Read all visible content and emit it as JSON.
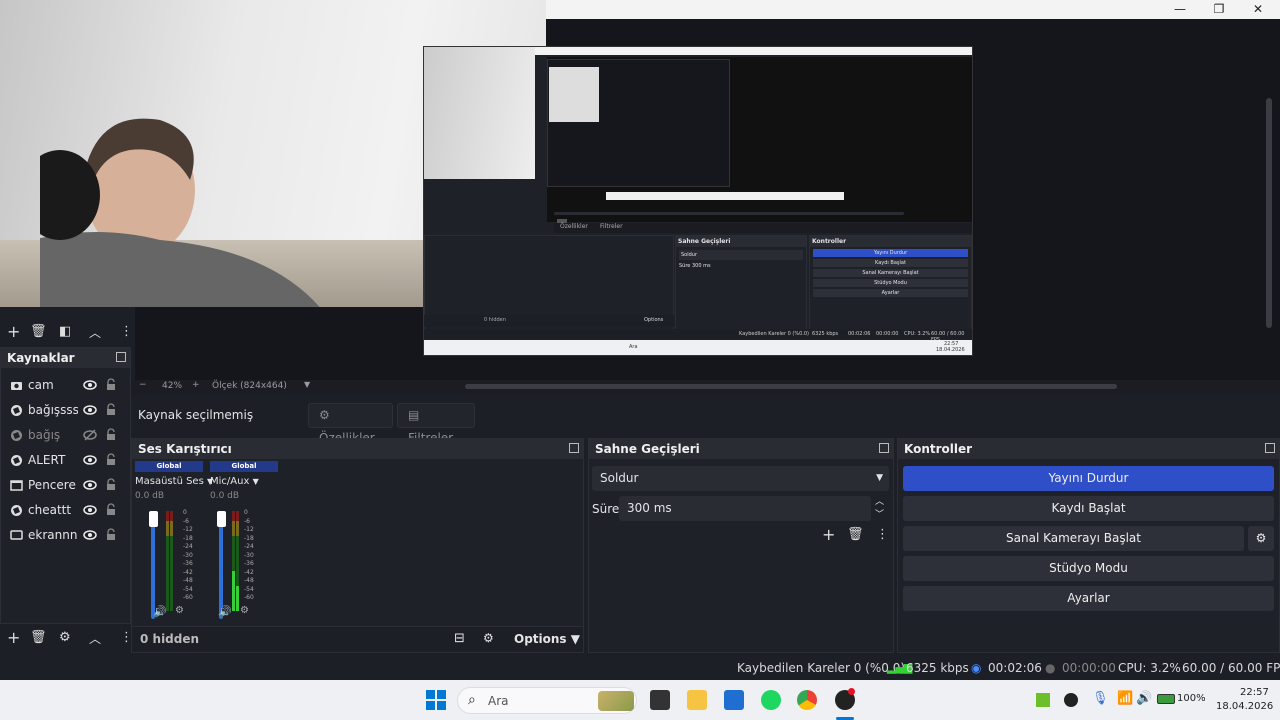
{
  "window": {
    "controls": [
      "—",
      "❐",
      "✕"
    ]
  },
  "preview": {
    "zoom_minus": "−",
    "zoom_percent": "42%",
    "zoom_plus": "+",
    "scale_label": "Ölçek (824x464)"
  },
  "nested_preview": {
    "controls_buttons": [
      "Yayını Durdur",
      "Kaydı Başlat",
      "Sanal Kamerayı Başlat",
      "Stüdyo Modu",
      "Ayarlar"
    ],
    "transitions_title": "Sahne Geçişleri",
    "controls_title": "Kontroller",
    "transition": "Soldur",
    "duration_label": "Süre",
    "duration": "300 ms",
    "tabs": [
      "Özellikler",
      "Filtreler"
    ],
    "hidden": "0 hidden",
    "options": "Options",
    "status": "Kaybedilen Kareler 0 (%0.0)",
    "kbps": "6325 kbps",
    "time": "00:02:06",
    "rec": "00:00:00",
    "cpu": "CPU: 3.2%",
    "fps": "60.00 / 60.00 FPS",
    "search": "Ara",
    "clock_time": "22:57",
    "clock_date": "18.04.2026"
  },
  "properties_bar": {
    "no_source": "Kaynak seçilmemiş",
    "properties": "Özellikler",
    "filters": "Filtreler"
  },
  "sources": {
    "title": "Kaynaklar",
    "items": [
      {
        "label": "cam",
        "icon": "camera-icon",
        "visible": true
      },
      {
        "label": "bağışsssss",
        "icon": "browser-icon",
        "visible": true
      },
      {
        "label": "bağış",
        "icon": "browser-icon",
        "visible": false
      },
      {
        "label": "ALERT",
        "icon": "browser-icon",
        "visible": true
      },
      {
        "label": "Pencere Y",
        "icon": "window-icon",
        "visible": true
      },
      {
        "label": "cheattt",
        "icon": "browser-icon",
        "visible": true
      },
      {
        "label": "ekrannnn",
        "icon": "monitor-icon",
        "visible": true
      }
    ]
  },
  "mixer": {
    "title": "Ses Karıştırıcı",
    "channels": [
      {
        "global": "Global",
        "name": "Masaüstü Ses",
        "db": "0.0 dB"
      },
      {
        "global": "Global",
        "name": "Mic/Aux",
        "db": "0.0 dB"
      }
    ],
    "ticks": [
      "0",
      "-6",
      "-12",
      "-18",
      "-24",
      "-30",
      "-36",
      "-42",
      "-48",
      "-54",
      "-60"
    ],
    "hidden": "0 hidden",
    "options": "Options"
  },
  "transitions": {
    "title": "Sahne Geçişleri",
    "transition": "Soldur",
    "duration_label": "Süre",
    "duration": "300 ms"
  },
  "controls": {
    "title": "Kontroller",
    "stop_stream": "Yayını Durdur",
    "start_record": "Kaydı Başlat",
    "start_virtualcam": "Sanal Kamerayı Başlat",
    "studio_mode": "Stüdyo Modu",
    "settings": "Ayarlar"
  },
  "statusbar": {
    "dropped": "Kaybedilen Kareler 0 (%0.0)",
    "kbps": "6325 kbps",
    "stream_time": "00:02:06",
    "rec_time": "00:00:00",
    "cpu": "CPU: 3.2%",
    "fps": "60.00 / 60.00 FPS"
  },
  "taskbar": {
    "search_placeholder": "Ara",
    "battery": "100%",
    "time": "22:57",
    "date": "18.04.2026"
  },
  "colors": {
    "accent": "#2f4fc8",
    "panel": "#1f2128",
    "background": "#1d1f26"
  }
}
